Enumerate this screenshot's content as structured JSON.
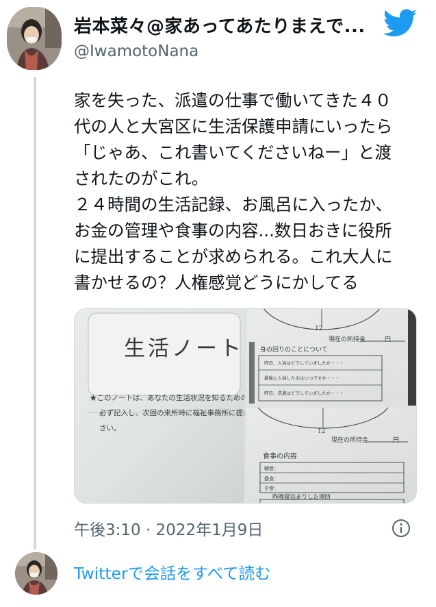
{
  "author": {
    "display_name": "岩本菜々@家あってあたりまえで...",
    "handle": "@IwamotoNana"
  },
  "tweet": {
    "lines": [
      "家を失った、派遣の仕事で働いてきた４０",
      "代の人と大宮区に生活保護申請にいったら",
      "「じゃあ、これ書いてくださいねー」と渡",
      "されたのがこれ。",
      "２４時間の生活記録、お風呂に入ったか、",
      "お金の管理や食事の内容...数日おきに役所",
      "に提出することが求められる。これ大人に",
      "書かせるの？人権感覚どうにかしてる"
    ],
    "timestamp": "午後3:10 · 2022年1月9日"
  },
  "media": {
    "photo1": {
      "title": "生活ノート",
      "line1": "★このノートは、あなたの生活状況を知るためのもので",
      "line2": "必ず記入し、次回の来所時に福祉事務所に提出してく",
      "line3": "さい。"
    },
    "photo2": {
      "clock_label": "12",
      "money_label": "現在の所持金",
      "money_unit": "円",
      "section_title": "身の回りのことについて",
      "q1": "昨日、入浴はどうしていましたか・・・",
      "q2": "最後に入浴したのはいつですか・・・",
      "q3": "昨日、洗濯はどうしていましたか・・・"
    },
    "photo3": {
      "clock_label": "12",
      "money_label": "現在の所持金",
      "money_unit": "円",
      "section_title": "食事の内容",
      "breakfast": "朝食：",
      "lunch": "昼食：",
      "dinner": "夕食：",
      "sleep_label": "昨晩寝泊まりした場所"
    }
  },
  "footer": {
    "read_all": "Twitterで会話をすべて読む"
  },
  "colors": {
    "accent": "#1d9bf0",
    "secondary_text": "#536471",
    "thread_line": "#cfd9de"
  },
  "icons": {
    "brand": "twitter-bird-icon",
    "info": "info-icon"
  }
}
